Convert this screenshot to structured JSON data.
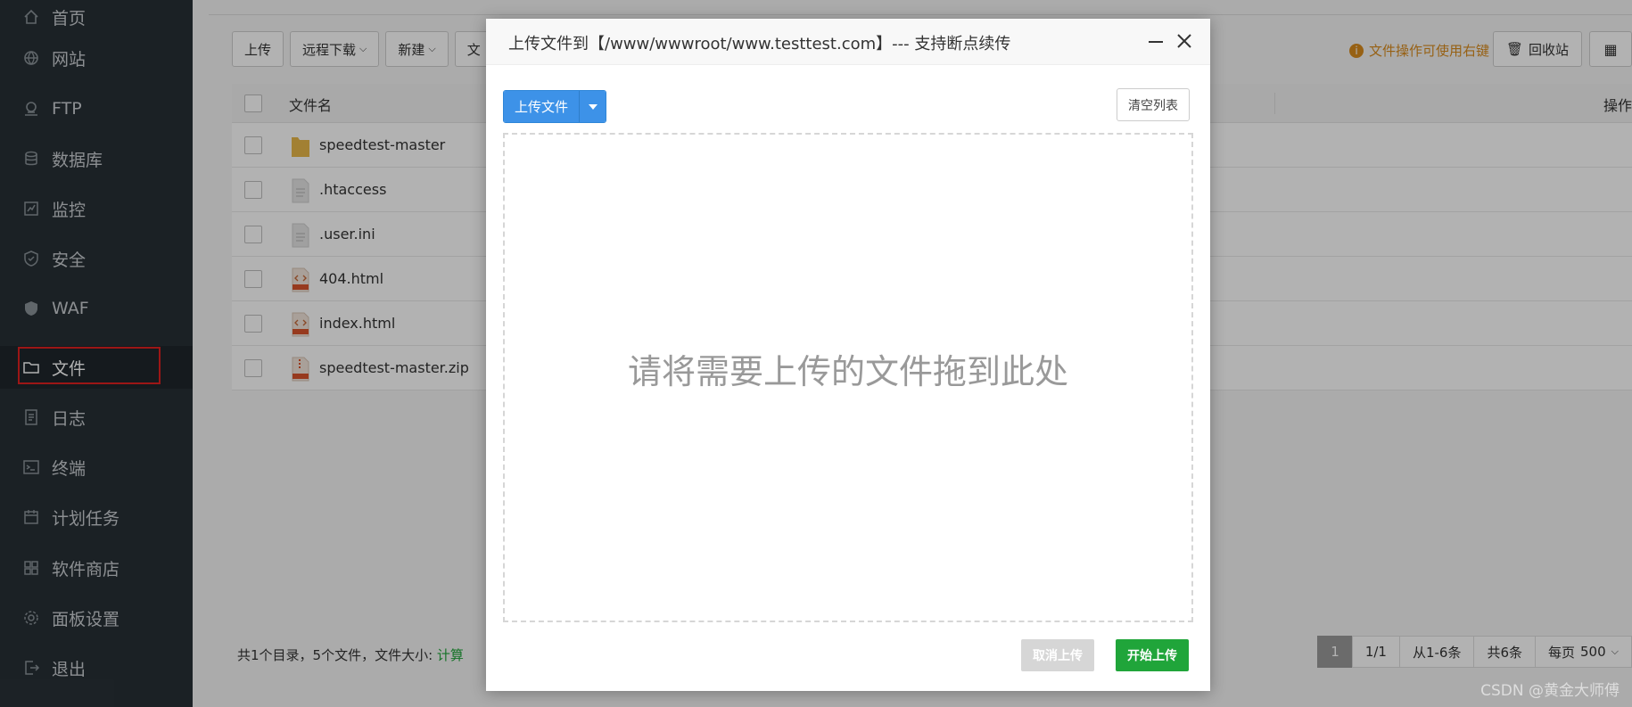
{
  "sidebar": {
    "items": [
      {
        "label": "首页",
        "icon": "home-icon"
      },
      {
        "label": "网站",
        "icon": "globe-icon"
      },
      {
        "label": "FTP",
        "icon": "ftp-icon"
      },
      {
        "label": "数据库",
        "icon": "database-icon"
      },
      {
        "label": "监控",
        "icon": "monitor-icon"
      },
      {
        "label": "安全",
        "icon": "shield-icon"
      },
      {
        "label": "WAF",
        "icon": "waf-shield-icon"
      },
      {
        "label": "文件",
        "icon": "folder-icon",
        "active": true
      },
      {
        "label": "日志",
        "icon": "log-icon"
      },
      {
        "label": "终端",
        "icon": "terminal-icon"
      },
      {
        "label": "计划任务",
        "icon": "calendar-icon"
      },
      {
        "label": "软件商店",
        "icon": "apps-icon"
      },
      {
        "label": "面板设置",
        "icon": "gear-icon"
      },
      {
        "label": "退出",
        "icon": "logout-icon"
      }
    ]
  },
  "toolbar": {
    "upload": "上传",
    "remote_download": "远程下载",
    "new": "新建",
    "partial": "文",
    "hint": "文件操作可使用右键",
    "recycle": "回收站"
  },
  "table": {
    "col_name": "文件名",
    "col_op": "操作",
    "rows": [
      {
        "name": "speedtest-master",
        "type": "folder"
      },
      {
        "name": ".htaccess",
        "type": "file"
      },
      {
        "name": ".user.ini",
        "type": "file"
      },
      {
        "name": "404.html",
        "type": "html"
      },
      {
        "name": "index.html",
        "type": "html"
      },
      {
        "name": "speedtest-master.zip",
        "type": "zip"
      }
    ]
  },
  "footer": {
    "summary": "共1个目录，5个文件，文件大小: ",
    "calc": "计算"
  },
  "pager": {
    "current": "1",
    "pages": "1/1",
    "range": "从1-6条",
    "total": "共6条",
    "per_page_label": "每页",
    "per_page_value": "500"
  },
  "modal": {
    "title": "上传文件到【/www/wwwroot/www.testtest.com】--- 支持断点续传",
    "upload_file": "上传文件",
    "clear_list": "清空列表",
    "drop_text": "请将需要上传的文件拖到此处",
    "cancel_upload": "取消上传",
    "start_upload": "开始上传"
  },
  "watermark": "CSDN @黄金大师傅",
  "colors": {
    "sidebar_bg": "#283036",
    "accent_blue": "#3d92e8",
    "accent_green": "#20a53a",
    "highlight_red": "#e02020",
    "hint_orange": "#d98b1e"
  }
}
